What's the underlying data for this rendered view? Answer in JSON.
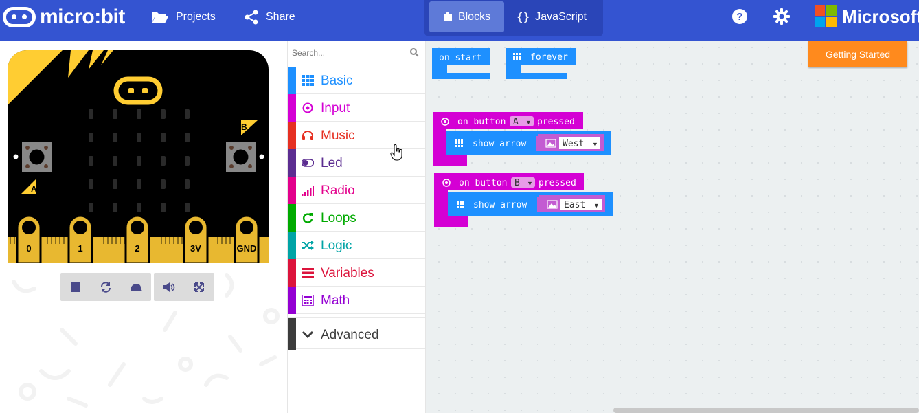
{
  "header": {
    "app_name": "micro:bit",
    "projects_label": "Projects",
    "share_label": "Share",
    "tab_blocks": "Blocks",
    "tab_javascript": "JavaScript",
    "brand": "Microsoft",
    "colors": {
      "bar": "#3454d1",
      "active_tab": "#5e7ad8"
    }
  },
  "simulator": {
    "button_labels": {
      "a": "A",
      "b": "B"
    },
    "pins": [
      "0",
      "1",
      "2",
      "3V",
      "GND"
    ],
    "toolbar_icons": [
      "stop-icon",
      "restart-icon",
      "slow-mo-icon",
      "mute-icon",
      "fullscreen-icon"
    ]
  },
  "toolbox": {
    "search_placeholder": "Search...",
    "categories": [
      {
        "label": "Basic",
        "color": "#1e90ff",
        "icon": "grid-icon"
      },
      {
        "label": "Input",
        "color": "#d400d4",
        "icon": "target-icon"
      },
      {
        "label": "Music",
        "color": "#e63022",
        "icon": "headphones-icon"
      },
      {
        "label": "Led",
        "color": "#5c2d91",
        "icon": "toggle-icon"
      },
      {
        "label": "Radio",
        "color": "#e3008c",
        "icon": "signal-bars-icon"
      },
      {
        "label": "Loops",
        "color": "#00aa00",
        "icon": "refresh-icon"
      },
      {
        "label": "Logic",
        "color": "#00a4a6",
        "icon": "shuffle-icon"
      },
      {
        "label": "Variables",
        "color": "#dc143c",
        "icon": "list-icon"
      },
      {
        "label": "Math",
        "color": "#9400d3",
        "icon": "calculator-icon"
      }
    ],
    "advanced_label": "Advanced"
  },
  "workspace": {
    "getting_started": "Getting Started",
    "blocks": {
      "on_start": "on start",
      "forever": "forever",
      "on_button_a": {
        "prefix": "on button",
        "button": "A",
        "suffix": "pressed"
      },
      "show_arrow_west": {
        "label": "show arrow",
        "value": "West"
      },
      "on_button_b": {
        "prefix": "on button",
        "button": "B",
        "suffix": "pressed"
      },
      "show_arrow_east": {
        "label": "show arrow",
        "value": "East"
      }
    },
    "colors": {
      "basic": "#1e90ff",
      "input": "#d400d4",
      "arrow_field": "#c35bd2"
    }
  }
}
